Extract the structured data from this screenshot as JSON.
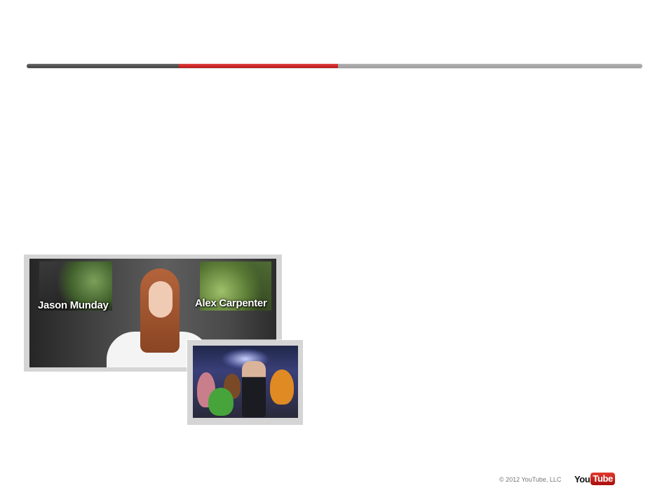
{
  "header": {
    "progress": {
      "segments": 3,
      "active_segment": 2,
      "active_color": "#cc1f1f",
      "completed_color": "#4a4a4a",
      "remaining_color": "#a8a8a8"
    }
  },
  "media": {
    "large_video": {
      "left_name": "Jason Munday",
      "right_name": "Alex Carpenter"
    },
    "small_video": {}
  },
  "footer": {
    "copyright": "© 2012 YouTube, LLC",
    "logo": {
      "you": "You",
      "tube": "Tube"
    }
  }
}
